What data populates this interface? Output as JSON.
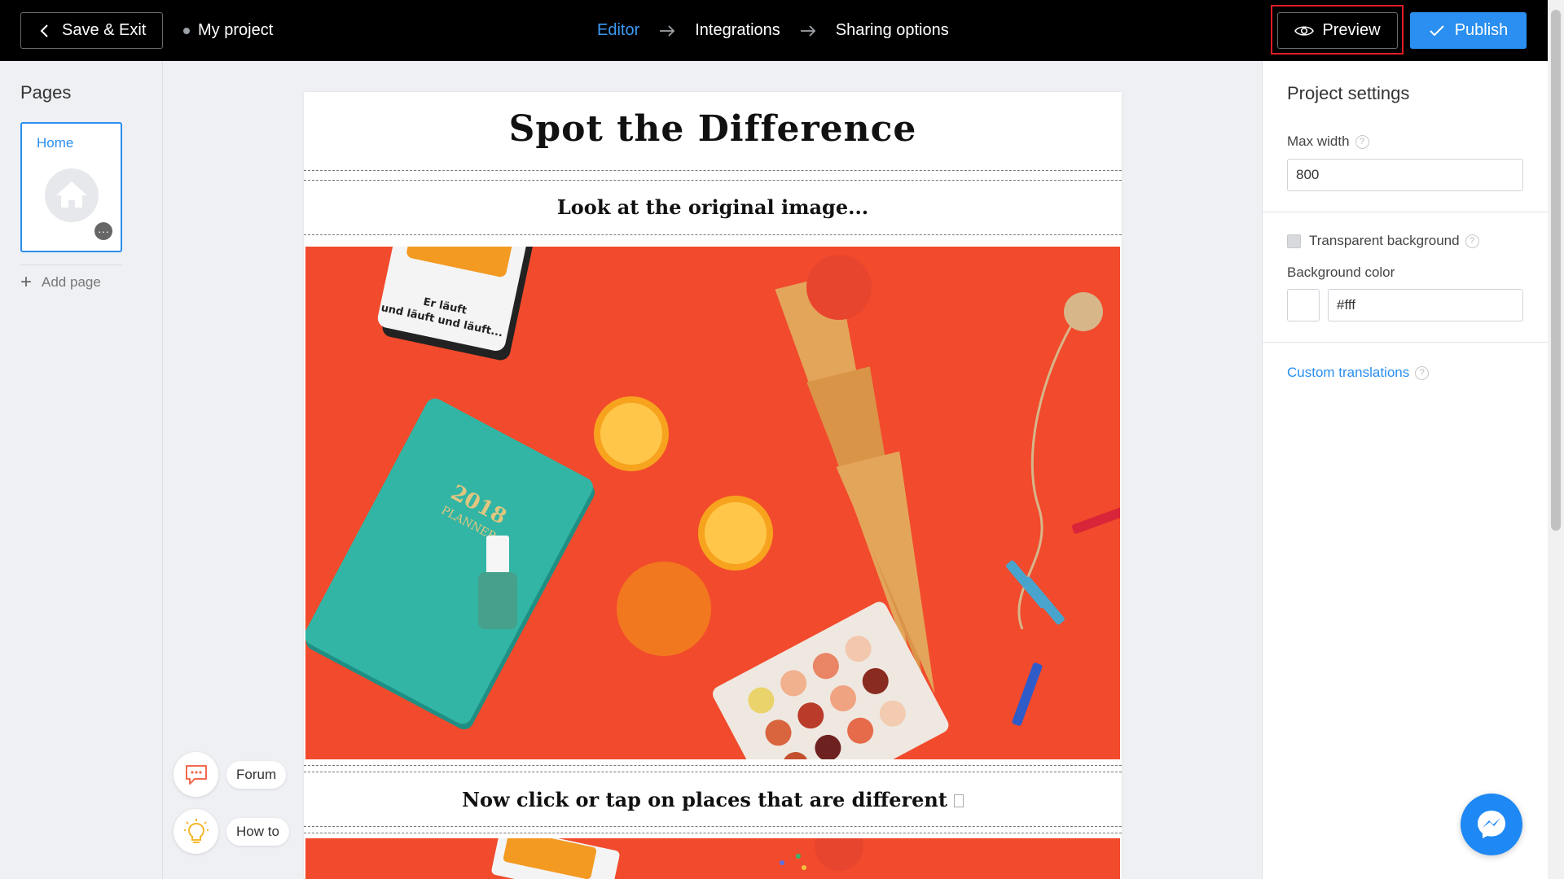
{
  "topbar": {
    "save_exit_label": "Save & Exit",
    "project_name": "My project",
    "steps": [
      {
        "label": "Editor",
        "active": true
      },
      {
        "label": "Integrations",
        "active": false
      },
      {
        "label": "Sharing options",
        "active": false
      }
    ],
    "preview_label": "Preview",
    "publish_label": "Publish"
  },
  "sidebar": {
    "title": "Pages",
    "pages": [
      {
        "label": "Home"
      }
    ],
    "add_page_label": "Add page"
  },
  "help": {
    "forum_label": "Forum",
    "howto_label": "How to"
  },
  "canvas": {
    "title": "Spot the Difference",
    "subtitle_1": "Look at the original image...",
    "image_text": [
      "Er läuft",
      "und läuft und läuft...",
      "2018",
      "PLANNER"
    ],
    "subtitle_2": "Now click or tap on places that are different"
  },
  "settings": {
    "title": "Project settings",
    "max_width_label": "Max width",
    "max_width_value": "800",
    "transparent_bg_label": "Transparent background",
    "transparent_bg_checked": false,
    "bg_color_label": "Background color",
    "bg_color_value": "#fff",
    "custom_translations_label": "Custom translations"
  },
  "colors": {
    "accent": "#2a8ff0",
    "topbar_bg": "#000000",
    "highlight_frame": "#e01c24",
    "photo_bg": "#f24a2c"
  }
}
